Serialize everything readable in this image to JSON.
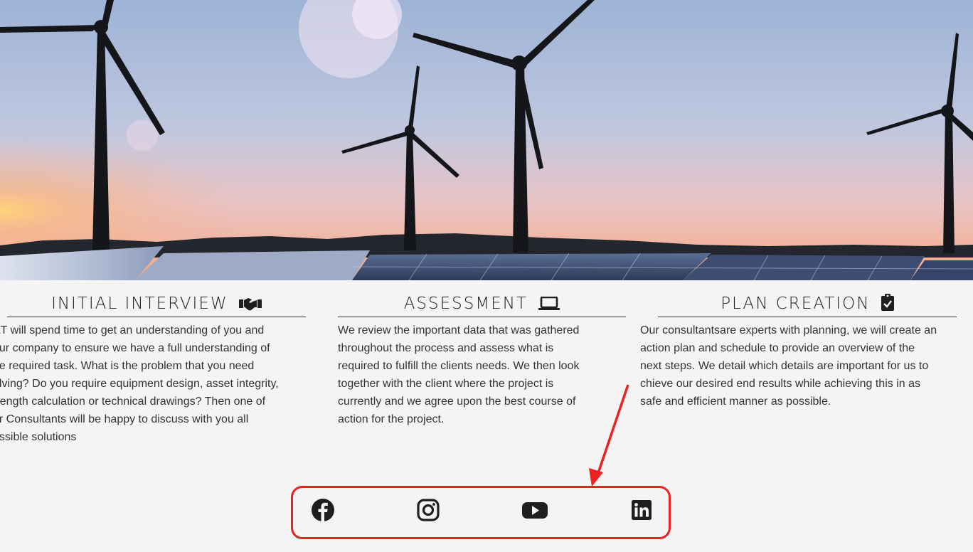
{
  "hero": {
    "image": "wind-turbines-solar-panels-sunset"
  },
  "columns": [
    {
      "title": "INITIAL INTERVIEW",
      "icon": "handshake-icon",
      "lines": [
        "&T will spend time to get an understanding of you and",
        "our company to ensure we have a full understanding of",
        "he required task. What is the problem that you need",
        "olving? Do you require equipment design, asset integrity,",
        "trength calculation or technical drawings? Then one of",
        "ur Consultants will be happy to discuss with you all",
        "ossible solutions"
      ]
    },
    {
      "title": "ASSESSMENT",
      "icon": "laptop-icon",
      "lines": [
        "We review the important data that was gathered",
        "throughout the process and assess what is",
        "required to fulfill the clients needs. We then look",
        "together with the client where the project is",
        "currently and we agree upon the best course of",
        "action for the project."
      ]
    },
    {
      "title": "PLAN CREATION",
      "icon": "clipboard-check-icon",
      "lines": [
        "Our consultantsare experts with planning, we will create an",
        "action plan and schedule to provide an overview of the",
        "next steps. We detail which details are important for us to",
        "chieve our desired end results while achieving this in as",
        "safe and efficient manner as possible."
      ]
    }
  ],
  "social": {
    "icons": [
      "facebook-icon",
      "instagram-icon",
      "youtube-icon",
      "linkedin-icon"
    ],
    "highlight_color": "#ec2222",
    "icon_color": "#1e1e1e"
  }
}
